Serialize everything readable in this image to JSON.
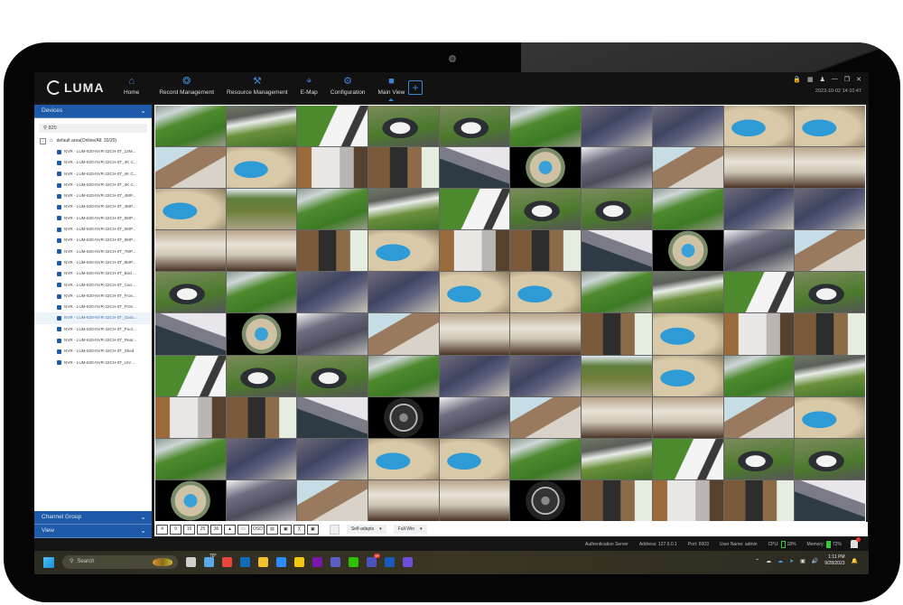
{
  "app": {
    "brand": "LUMA",
    "datetime": "2023-10-02 14:10:47",
    "nav": [
      {
        "label": "Home",
        "icon": "home-icon"
      },
      {
        "label": "Record Management",
        "icon": "film-reel-icon"
      },
      {
        "label": "Resource Management",
        "icon": "tools-icon"
      },
      {
        "label": "E-Map",
        "icon": "map-pin-icon"
      },
      {
        "label": "Configuration",
        "icon": "gear-icon"
      },
      {
        "label": "Main View",
        "icon": "video-camera-icon",
        "active": true
      }
    ],
    "add_label": "+",
    "window_controls": [
      "lock-icon",
      "grid-icon",
      "user-icon",
      "minimize-icon",
      "restore-icon",
      "close-icon"
    ]
  },
  "sidebar": {
    "devices_label": "Devices",
    "search_value": "820",
    "root_label": "default area(Online/All: 20/20)",
    "devices": [
      "NVR - LUM-820-NVR-32CH-0T_12M...",
      "NVR - LUM-820-NVR-32CH-0T_4K C...",
      "NVR - LUM-820-NVR-32CH-0T_4K C...",
      "NVR - LUM-820-NVR-32CH-0T_4K C...",
      "NVR - LUM-820-NVR-32CH-0T_4MP...",
      "NVR - LUM-820-NVR-32CH-0T_4MP...",
      "NVR - LUM-820-NVR-32CH-0T_5MP...",
      "NVR - LUM-820-NVR-32CH-0T_5MP...",
      "NVR - LUM-820-NVR-32CH-0T_6MP...",
      "NVR - LUM-820-NVR-32CH-0T_7MP...",
      "NVR - LUM-820-NVR-32CH-0T_8MP...",
      "NVR - LUM-820-NVR-32CH-0T_Bird ...",
      "NVR - LUM-820-NVR-32CH-0T_Can...",
      "NVR - LUM-820-NVR-32CH-0T_Fron...",
      "NVR - LUM-820-NVR-32CH-0T_Fron...",
      "NVR - LUM-820-NVR-32CH-0T_Gara...",
      "NVR - LUM-820-NVR-32CH-0T_Pool...",
      "NVR - LUM-820-NVR-32CH-0T_Rear...",
      "NVR - LUM-820-NVR-32CH-0T_Shed",
      "NVR - LUM-820-NVR-32CH-0T_Unr ..."
    ],
    "selected_index": 15,
    "channel_group_label": "Channel Group",
    "view_label": "View"
  },
  "grid": {
    "rows": 10,
    "cols": 10,
    "scenes": [
      "lawn",
      "drive",
      "side",
      "car",
      "car",
      "lawn",
      "patio",
      "patio",
      "pool",
      "pool",
      "corner",
      "pool",
      "shed",
      "gate",
      "umb",
      "fish",
      "cluttered",
      "corner",
      "room",
      "room",
      "pool",
      "yard",
      "lawn",
      "drive",
      "side",
      "car",
      "car",
      "lawn",
      "patio",
      "patio",
      "room",
      "room",
      "gate",
      "pool",
      "shed",
      "gate",
      "umb",
      "fish",
      "cluttered",
      "corner",
      "car",
      "lawn",
      "patio",
      "patio",
      "pool",
      "pool",
      "lawn",
      "drive",
      "side",
      "car",
      "umb",
      "fish",
      "cluttered",
      "corner",
      "room",
      "room",
      "gate",
      "pool",
      "shed",
      "gate",
      "side",
      "car",
      "car",
      "lawn",
      "patio",
      "patio",
      "yard",
      "pool",
      "lawn",
      "drive",
      "shed",
      "gate",
      "umb",
      "fishbw",
      "cluttered",
      "corner",
      "room",
      "room",
      "corner",
      "pool",
      "lawn",
      "patio",
      "patio",
      "pool",
      "pool",
      "lawn",
      "drive",
      "side",
      "car",
      "car",
      "fish",
      "cluttered",
      "corner",
      "room",
      "room",
      "fishbw",
      "gate",
      "shed",
      "gate",
      "umb"
    ]
  },
  "toolbar": {
    "layouts": [
      "4",
      "9",
      "16",
      "25",
      "36"
    ],
    "tool_icons": [
      "custom-layout-icon",
      "fullscreen-icon",
      "osd-icon",
      "stream-icon",
      "snapshot-icon",
      "close-all-icon",
      "window-icon"
    ],
    "aspect_select": "Self-adapts",
    "window_select": "Full-Win"
  },
  "status": {
    "server": "Authentication Server",
    "address": "Address: 127.0.0.1",
    "port": "Port: 6003",
    "user": "User Name: admin",
    "cpu_label": "CPU:",
    "cpu_value": "18%",
    "memory_label": "Memory:",
    "memory_value": "72%"
  },
  "taskbar": {
    "search_placeholder": "Search",
    "weather": "70°",
    "time": "1:11 PM",
    "date": "9/28/2023",
    "apps": [
      {
        "name": "task-view",
        "color": "#cfcfcf"
      },
      {
        "name": "weather",
        "color": "#5aa9e6"
      },
      {
        "name": "chrome",
        "color": "#e8453c"
      },
      {
        "name": "outlook",
        "color": "#0f6cbd"
      },
      {
        "name": "file-explorer",
        "color": "#f2c12e"
      },
      {
        "name": "zoom",
        "color": "#2d8cff"
      },
      {
        "name": "power-bi",
        "color": "#f2c811"
      },
      {
        "name": "onenote",
        "color": "#7719aa"
      },
      {
        "name": "teams",
        "color": "#5b5fc7"
      },
      {
        "name": "wechat",
        "color": "#2dc100"
      },
      {
        "name": "teams-work",
        "color": "#4b53bc",
        "badge": "9+"
      },
      {
        "name": "word",
        "color": "#185abd"
      },
      {
        "name": "cortana",
        "color": "#6b4fd8"
      }
    ]
  }
}
